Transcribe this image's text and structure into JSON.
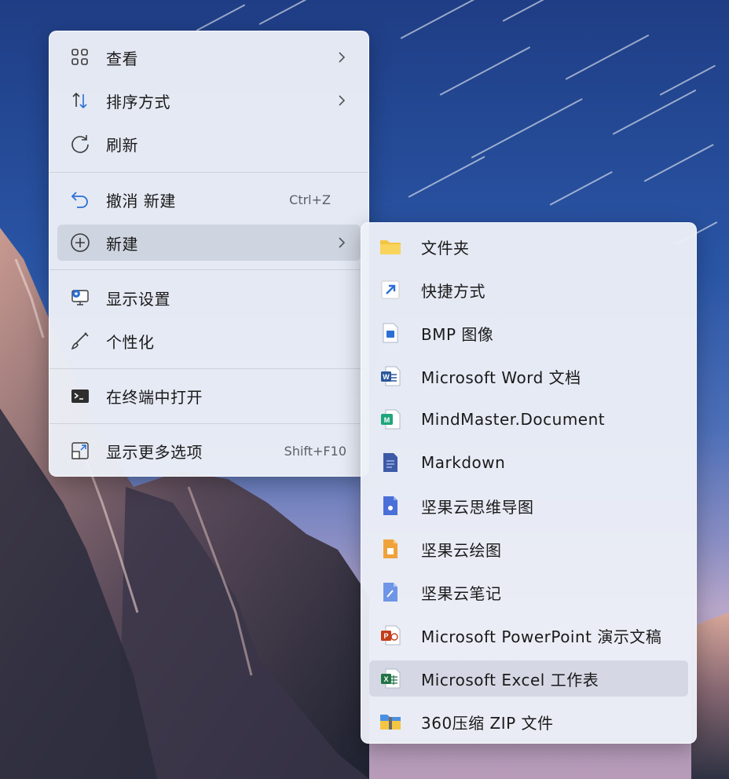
{
  "context_menu": {
    "items": [
      {
        "label": "查看",
        "icon": "grid-view-icon",
        "has_submenu": true
      },
      {
        "label": "排序方式",
        "icon": "sort-arrows-icon",
        "has_submenu": true
      },
      {
        "label": "刷新",
        "icon": "refresh-icon",
        "has_submenu": false
      },
      {
        "label": "撤消 新建",
        "icon": "undo-icon",
        "shortcut": "Ctrl+Z"
      },
      {
        "label": "新建",
        "icon": "add-circle-icon",
        "has_submenu": true,
        "active": true
      },
      {
        "label": "显示设置",
        "icon": "display-settings-icon"
      },
      {
        "label": "个性化",
        "icon": "brush-icon"
      },
      {
        "label": "在终端中打开",
        "icon": "terminal-icon"
      },
      {
        "label": "显示更多选项",
        "icon": "more-options-icon",
        "shortcut": "Shift+F10"
      }
    ]
  },
  "new_submenu": {
    "items": [
      {
        "label": "文件夹",
        "icon": "folder-icon"
      },
      {
        "label": "快捷方式",
        "icon": "shortcut-arrow-icon"
      },
      {
        "label": "BMP 图像",
        "icon": "bmp-image-icon"
      },
      {
        "label": "Microsoft Word 文档",
        "icon": "word-doc-icon"
      },
      {
        "label": "MindMaster.Document",
        "icon": "mindmaster-icon"
      },
      {
        "label": "Markdown",
        "icon": "markdown-file-icon"
      },
      {
        "label": "坚果云思维导图",
        "icon": "nutstore-mindmap-icon"
      },
      {
        "label": "坚果云绘图",
        "icon": "nutstore-drawing-icon"
      },
      {
        "label": "坚果云笔记",
        "icon": "nutstore-note-icon"
      },
      {
        "label": "Microsoft PowerPoint 演示文稿",
        "icon": "powerpoint-icon"
      },
      {
        "label": "Microsoft Excel 工作表",
        "icon": "excel-icon",
        "hovered": true
      },
      {
        "label": "360压缩 ZIP 文件",
        "icon": "zip-archive-icon"
      }
    ]
  },
  "colors": {
    "accent": "#2b6fd6",
    "menu_bg": "#eceff7",
    "word_blue": "#2b579a",
    "excel_green": "#217346",
    "ppt_red": "#c43e1c",
    "folder_yellow": "#f4c542"
  }
}
